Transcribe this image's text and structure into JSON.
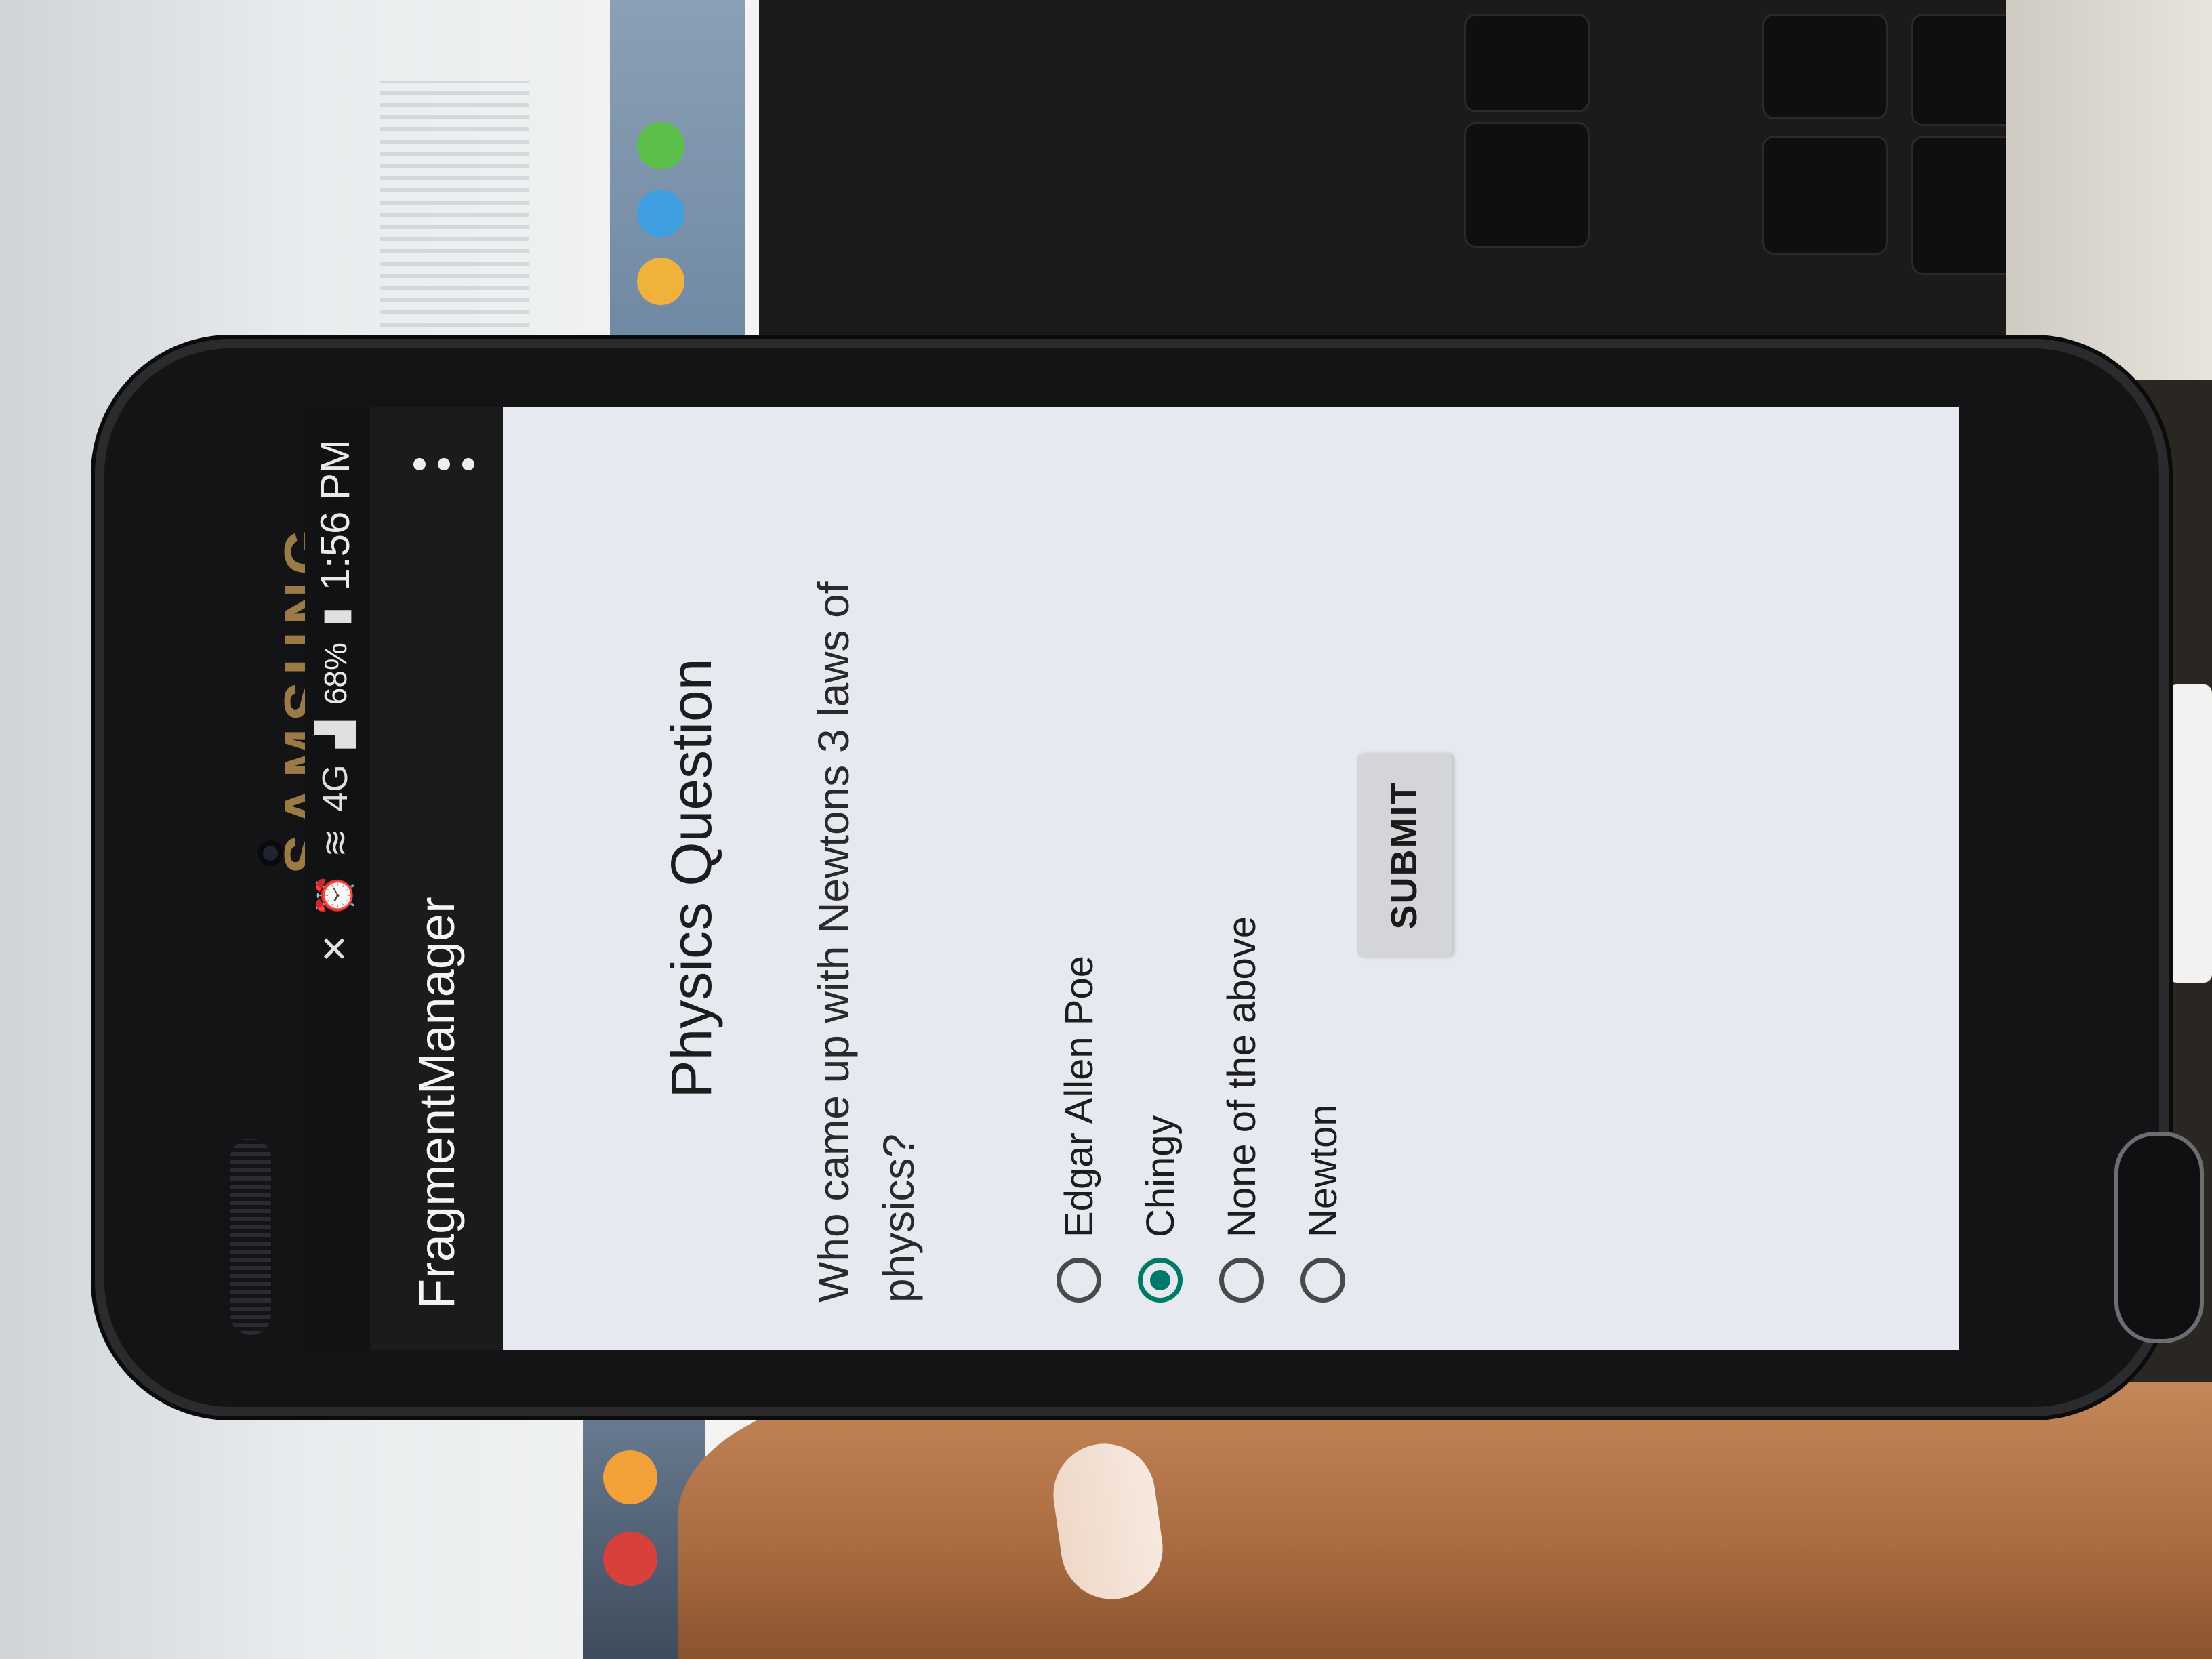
{
  "device": {
    "brand": "SAMSUNG"
  },
  "status_bar": {
    "time": "1:56 PM",
    "battery": "68%",
    "network": "4G",
    "icons": [
      "mute-icon",
      "alarm-icon",
      "wifi-icon",
      "lte-icon",
      "signal-icon",
      "battery-icon"
    ]
  },
  "action_bar": {
    "title": "FragmentManager",
    "overflow_icon": "overflow-menu-icon"
  },
  "quiz": {
    "heading": "Physics Question",
    "question": "Who came up with Newtons 3 laws of physics?",
    "options": [
      {
        "label": "Edgar Allen Poe",
        "checked": false
      },
      {
        "label": "Chingy",
        "checked": true
      },
      {
        "label": "None of the above",
        "checked": false
      },
      {
        "label": "Newton",
        "checked": false
      }
    ],
    "submit_label": "SUBMIT"
  },
  "background_keys": [
    "option",
    "alt",
    "mand"
  ],
  "colors": {
    "accent": "#00796b",
    "action_bar": "#1a1b1d",
    "screen_bg": "#e6e9ef"
  }
}
